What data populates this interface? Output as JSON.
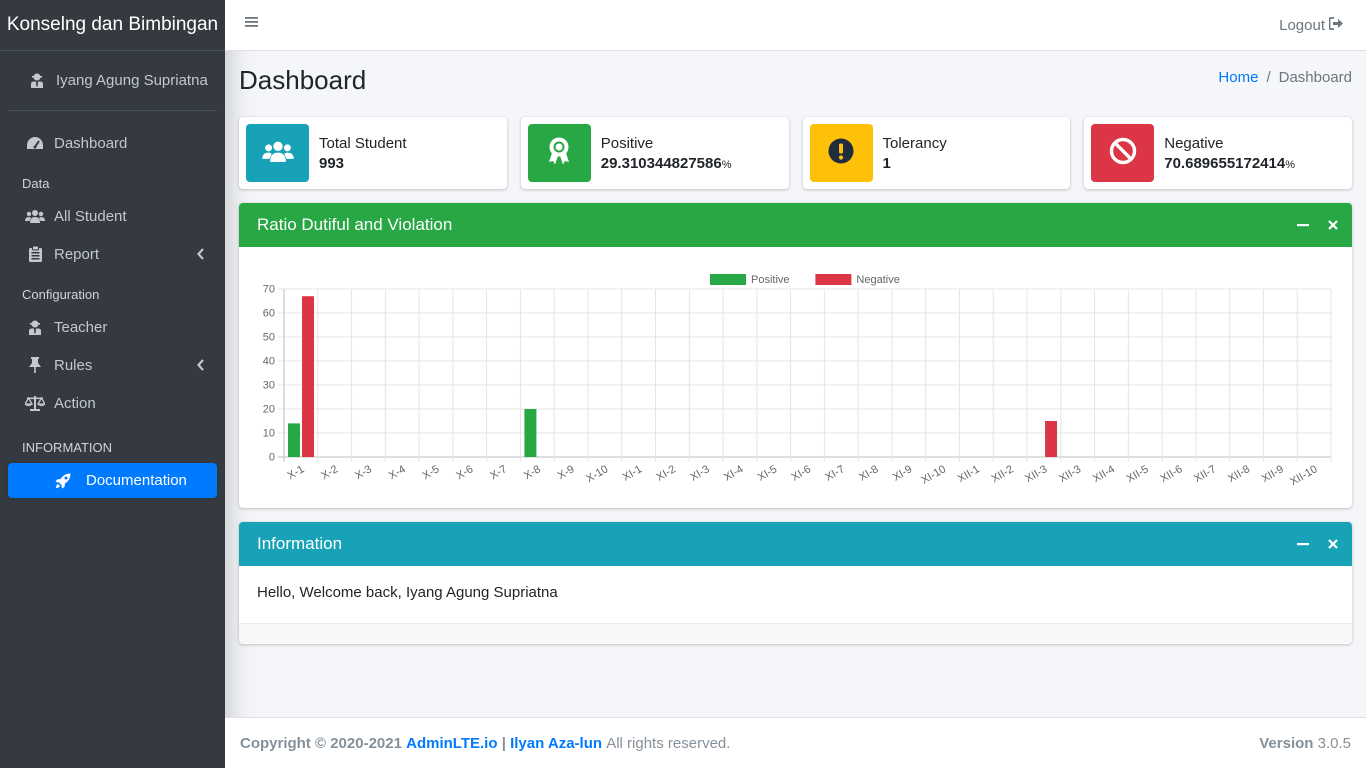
{
  "sidebar": {
    "brand": "Konselng dan Bimbingan",
    "user_name": "Iyang Agung Supriatna",
    "dashboard": "Dashboard",
    "header_data": "Data",
    "all_student": "All Student",
    "report": "Report",
    "header_config": "Configuration",
    "teacher": "Teacher",
    "rules": "Rules",
    "action": "Action",
    "header_info": "INFORMATION",
    "documentation": "Documentation"
  },
  "header": {
    "logout": "Logout"
  },
  "page": {
    "title": "Dashboard",
    "breadcrumb_home": "Home",
    "breadcrumb_current": "Dashboard"
  },
  "stats": {
    "total_label": "Total Student",
    "total_value": "993",
    "positive_label": "Positive",
    "positive_value": "29.310344827586",
    "positive_unit": "%",
    "tolerancy_label": "Tolerancy",
    "tolerancy_value": "1",
    "negative_label": "Negative",
    "negative_value": "70.689655172414",
    "negative_unit": "%"
  },
  "colors": {
    "green": "#28a745",
    "red": "#dc3545",
    "yellow": "#ffc107",
    "teal": "#17a2b8",
    "blue": "#007bff"
  },
  "chart_card": {
    "title": "Ratio Dutiful and Violation"
  },
  "info_card": {
    "title": "Information",
    "message": "Hello, Welcome back, Iyang Agung Supriatna"
  },
  "footer": {
    "copyright": "Copyright © 2020-2021",
    "link1": "AdminLTE.io",
    "separator": "|",
    "link2": "Ilyan Aza-lun",
    "rights": "All rights reserved.",
    "version_label": "Version",
    "version_value": "3.0.5"
  },
  "chart_data": {
    "type": "bar",
    "categories": [
      "X-1",
      "X-2",
      "X-3",
      "X-4",
      "X-5",
      "X-6",
      "X-7",
      "X-8",
      "X-9",
      "X-10",
      "XI-1",
      "XI-2",
      "XI-3",
      "XI-4",
      "XI-5",
      "XI-6",
      "XI-7",
      "XI-8",
      "XI-9",
      "XI-10",
      "XII-1",
      "XII-2",
      "XII-3",
      "XII-3",
      "XII-4",
      "XII-5",
      "XII-6",
      "XII-7",
      "XII-8",
      "XII-9",
      "XII-10"
    ],
    "series": [
      {
        "name": "Positive",
        "color": "#28a745",
        "values": [
          14,
          0,
          0,
          0,
          0,
          0,
          0,
          20,
          0,
          0,
          0,
          0,
          0,
          0,
          0,
          0,
          0,
          0,
          0,
          0,
          0,
          0,
          0,
          0,
          0,
          0,
          0,
          0,
          0,
          0,
          0
        ]
      },
      {
        "name": "Negative",
        "color": "#dc3545",
        "values": [
          67,
          0,
          0,
          0,
          0,
          0,
          0,
          0,
          0,
          0,
          0,
          0,
          0,
          0,
          0,
          0,
          0,
          0,
          0,
          0,
          0,
          0,
          15,
          0,
          0,
          0,
          0,
          0,
          0,
          0,
          0
        ]
      }
    ],
    "yticks": [
      0,
      10,
      20,
      30,
      40,
      50,
      60,
      70
    ],
    "ylim": [
      0,
      70
    ],
    "legend": "top-center",
    "grid": true
  }
}
